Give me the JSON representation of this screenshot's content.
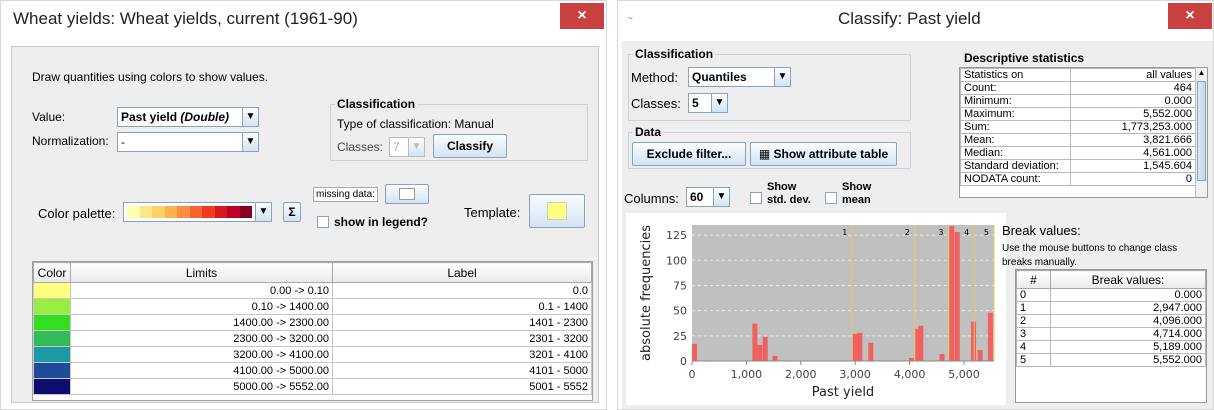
{
  "left": {
    "title": "Wheat yields: Wheat yields, current (1961-90)",
    "close": "×",
    "intro": "Draw quantities using colors to show values.",
    "value_label": "Value:",
    "value_selected": "Past yield",
    "value_type": "(Double)",
    "norm_label": "Normalization:",
    "norm_selected": "-",
    "classification": {
      "title": "Classification",
      "type_text": "Type of classification: Manual",
      "classes_label": "Classes:",
      "classes_value": "7",
      "classify_button": "Classify"
    },
    "palette_label": "Color palette:",
    "palette_colors": [
      "#ffffb2",
      "#fee98a",
      "#fed068",
      "#feb24c",
      "#fd8d3c",
      "#f8632e",
      "#f03b20",
      "#d7191c",
      "#bd0026",
      "#8a0022"
    ],
    "missing_label": "missing data:",
    "show_legend": "show in legend?",
    "template_label": "Template:",
    "template_color": "#ffff80",
    "table": {
      "headers": [
        "Color",
        "Limits",
        "Label"
      ],
      "rows": [
        {
          "color": "#ffff80",
          "limits": "0.00 -> 0.10",
          "label": "0.0"
        },
        {
          "color": "#99ee44",
          "limits": "0.10 -> 1400.00",
          "label": "0.1 - 1400"
        },
        {
          "color": "#33dd22",
          "limits": "1400.00 -> 2300.00",
          "label": "1401 - 2300"
        },
        {
          "color": "#33bb55",
          "limits": "2300.00 -> 3200.00",
          "label": "2301 - 3200"
        },
        {
          "color": "#1e9aa6",
          "limits": "3200.00 -> 4100.00",
          "label": "3201 - 4100"
        },
        {
          "color": "#1f4c99",
          "limits": "4100.00 -> 5000.00",
          "label": "4101 - 5000"
        },
        {
          "color": "#0d0d70",
          "limits": "5000.00 -> 5552.00",
          "label": "5001 - 5552"
        }
      ]
    }
  },
  "right": {
    "title": "Classify: Past yield",
    "close": "×",
    "classification": {
      "title": "Classification",
      "method_label": "Method:",
      "method_value": "Quantiles",
      "classes_label": "Classes:",
      "classes_value": "5"
    },
    "data": {
      "title": "Data",
      "exclude_button": "Exclude filter...",
      "show_table_button": "Show attribute table"
    },
    "columns_label": "Columns:",
    "columns_value": "60",
    "show_std": "Show std. dev.",
    "show_mean": "Show mean",
    "stats": {
      "title": "Descriptive statistics",
      "rows": [
        [
          "Statistics on",
          "all values"
        ],
        [
          "Count:",
          "464"
        ],
        [
          "Minimum:",
          "0.000"
        ],
        [
          "Maximum:",
          "5,552.000"
        ],
        [
          "Sum:",
          "1,773,253.000"
        ],
        [
          "Mean:",
          "3,821.666"
        ],
        [
          "Median:",
          "4,561.000"
        ],
        [
          "Standard deviation:",
          "1,545.604"
        ],
        [
          "NODATA count:",
          "0"
        ]
      ]
    },
    "breaks": {
      "title": "Break values:",
      "hint": "Use the mouse buttons to change class breaks manually.",
      "headers": [
        "#",
        "Break values:"
      ],
      "rows": [
        [
          "0",
          "0.000"
        ],
        [
          "1",
          "2,947.000"
        ],
        [
          "2",
          "4,096.000"
        ],
        [
          "3",
          "4,714.000"
        ],
        [
          "4",
          "5,189.000"
        ],
        [
          "5",
          "5,552.000"
        ]
      ]
    }
  },
  "chart_data": {
    "type": "bar",
    "xlabel": "Past yield",
    "ylabel": "absolute frequencies",
    "xlim": [
      0,
      5552
    ],
    "ylim": [
      0,
      135
    ],
    "xticks": [
      0,
      1000,
      2000,
      3000,
      4000,
      5000
    ],
    "xtick_labels": [
      "0",
      "1,000",
      "2,000",
      "3,000",
      "4,000",
      "5,000"
    ],
    "yticks": [
      0,
      25,
      50,
      75,
      100,
      125
    ],
    "bar_color": "#f06060",
    "bar_width": 92,
    "bars": [
      {
        "x": 0,
        "y": 17
      },
      {
        "x": 1110,
        "y": 37
      },
      {
        "x": 1200,
        "y": 16
      },
      {
        "x": 1300,
        "y": 24
      },
      {
        "x": 1480,
        "y": 5
      },
      {
        "x": 2950,
        "y": 27
      },
      {
        "x": 3040,
        "y": 28
      },
      {
        "x": 3240,
        "y": 18
      },
      {
        "x": 3990,
        "y": 3
      },
      {
        "x": 4090,
        "y": 32
      },
      {
        "x": 4160,
        "y": 35
      },
      {
        "x": 4550,
        "y": 7
      },
      {
        "x": 4730,
        "y": 134
      },
      {
        "x": 4830,
        "y": 128
      },
      {
        "x": 5130,
        "y": 39
      },
      {
        "x": 5250,
        "y": 11
      },
      {
        "x": 5440,
        "y": 48
      }
    ],
    "breaks": [
      {
        "label": "1",
        "x": 2947
      },
      {
        "label": "2",
        "x": 4096
      },
      {
        "label": "3",
        "x": 4714
      },
      {
        "label": "4",
        "x": 5189
      },
      {
        "label": "5",
        "x": 5552
      }
    ],
    "plot_bg": "#c0c0c0",
    "break_color": "#e8c860"
  }
}
